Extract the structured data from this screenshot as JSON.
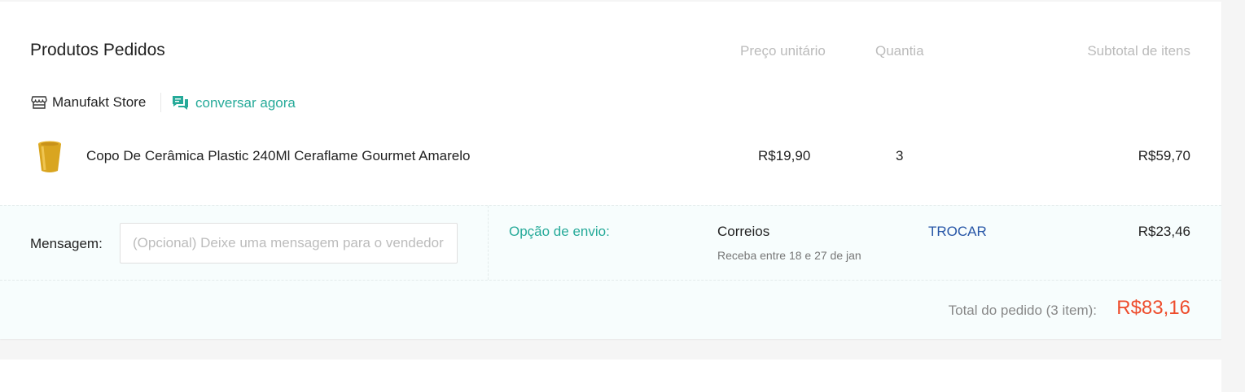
{
  "section": {
    "title": "Produtos Pedidos",
    "col_price": "Preço unitário",
    "col_qty": "Quantia",
    "col_subtotal": "Subtotal de itens"
  },
  "store": {
    "icon": "store-icon",
    "name": "Manufakt Store",
    "chat_icon": "chat-icon",
    "chat_label": "conversar agora"
  },
  "item": {
    "thumbnail": "yellow-cup-image",
    "name": "Copo De Cerâmica Plastic 240Ml Ceraflame Gourmet Amarelo",
    "price": "R$19,90",
    "quantity": "3",
    "subtotal": "R$59,70"
  },
  "message": {
    "label": "Mensagem:",
    "placeholder": "(Opcional) Deixe uma mensagem para o vendedor",
    "value": ""
  },
  "shipping": {
    "label": "Opção de envio:",
    "carrier": "Correios",
    "eta": "Receba entre 18 e 27 de jan",
    "change_label": "TROCAR",
    "price": "R$23,46"
  },
  "total": {
    "label": "Total do pedido (3 item):",
    "value": "R$83,16"
  },
  "colors": {
    "accent_teal": "#26aa99",
    "price_red": "#ee4d2d",
    "link_blue": "#2756a7"
  }
}
